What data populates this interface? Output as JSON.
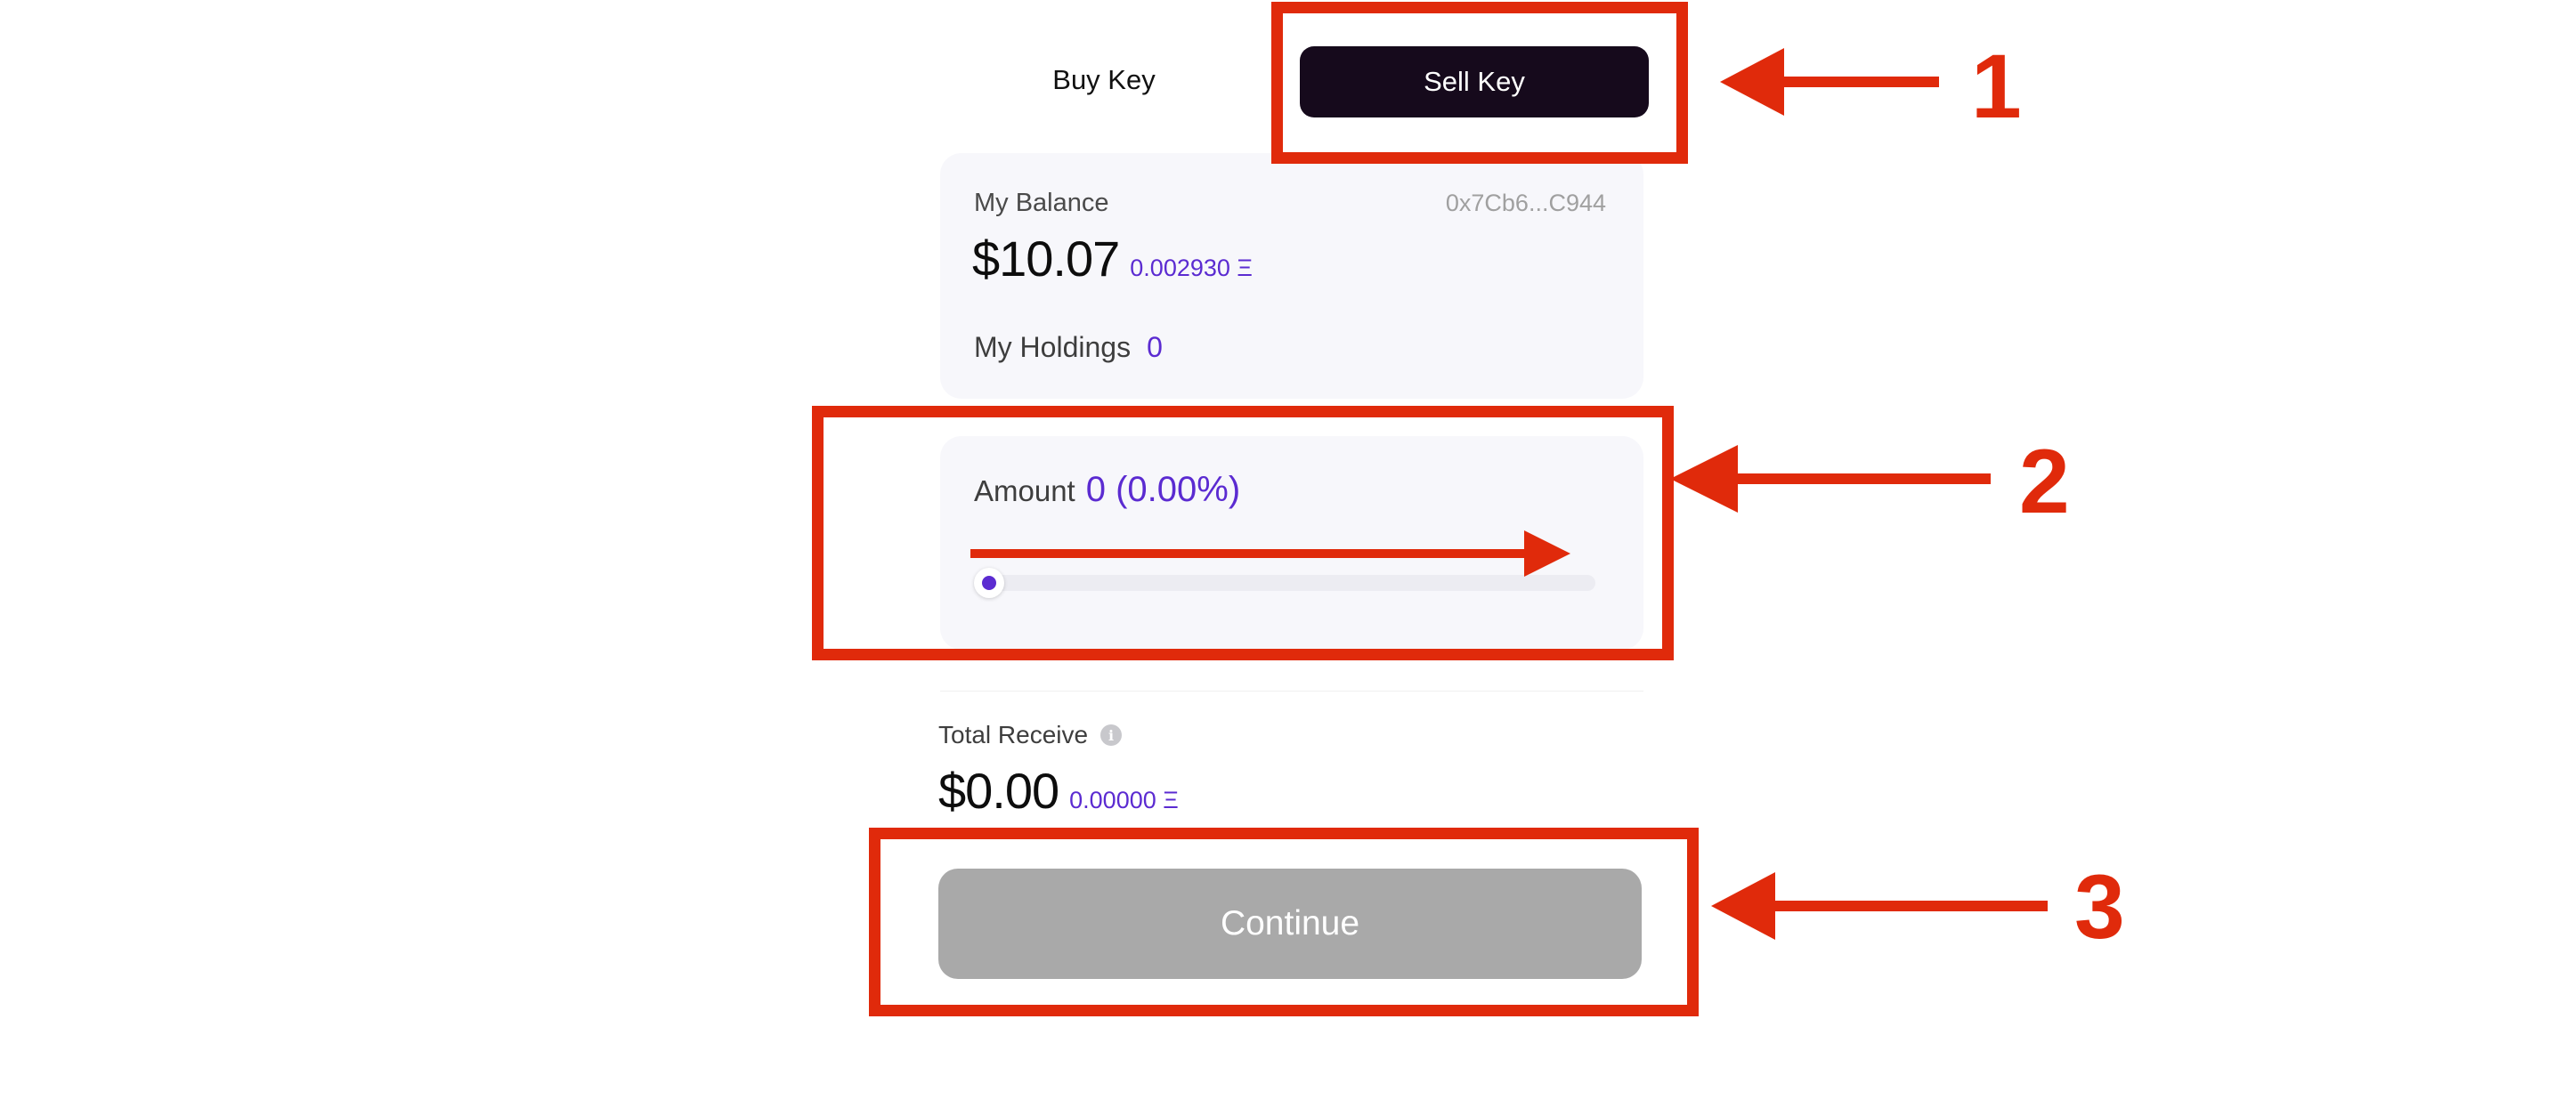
{
  "tabs": {
    "buy_label": "Buy Key",
    "sell_label": "Sell Key",
    "active": "Sell Key"
  },
  "balance": {
    "label": "My Balance",
    "address": "0x7Cb6...C944",
    "usd": "$10.07",
    "eth": "0.002930 Ξ",
    "holdings_label": "My Holdings",
    "holdings_value": "0"
  },
  "amount": {
    "label": "Amount",
    "value": "0 (0.00%)",
    "slider_fraction": 0
  },
  "total": {
    "label": "Total Receive",
    "info_icon": "info-icon",
    "usd": "$0.00",
    "eth": "0.00000 Ξ"
  },
  "continue_label": "Continue",
  "annotations": [
    "1",
    "2",
    "3"
  ],
  "colors": {
    "accent_purple": "#5b2bd1",
    "active_tab_bg": "#160a1c",
    "card_bg": "#f7f7fb",
    "continue_disabled_bg": "#a9a9a9",
    "annotation_red": "#e02a0b"
  }
}
